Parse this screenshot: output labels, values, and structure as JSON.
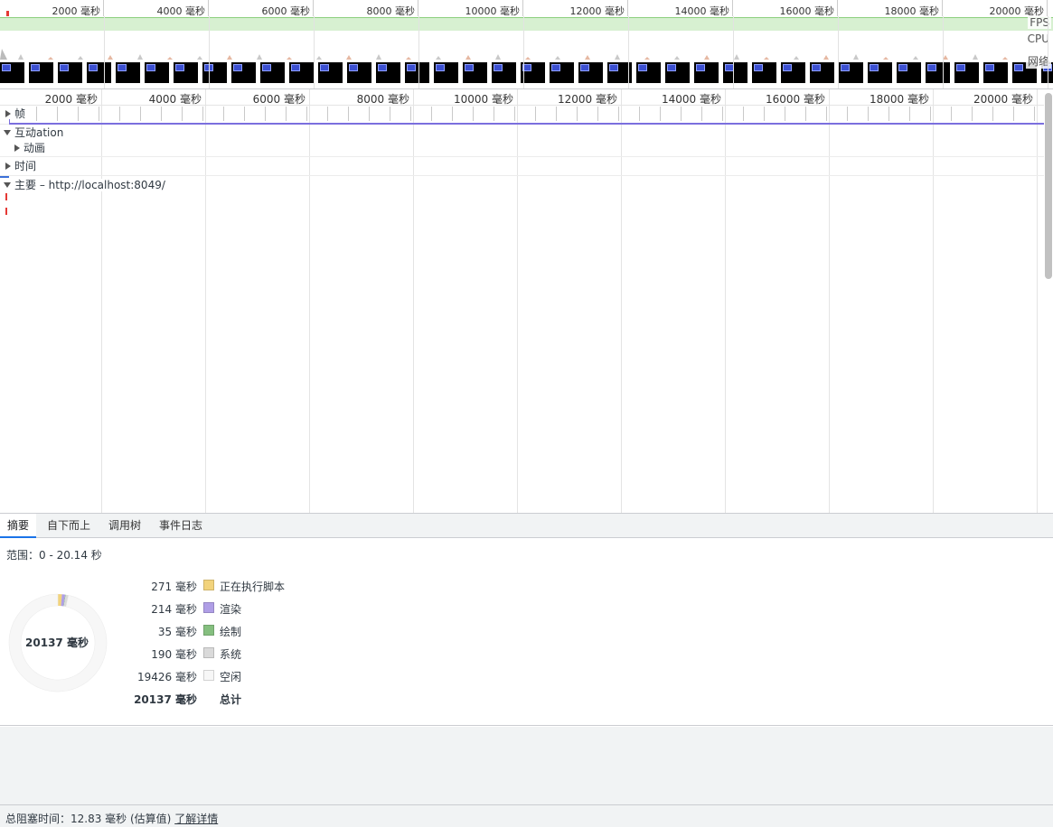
{
  "overview": {
    "ticks": [
      "2000 毫秒",
      "4000 毫秒",
      "6000 毫秒",
      "8000 毫秒",
      "10000 毫秒",
      "12000 毫秒",
      "14000 毫秒",
      "16000 毫秒",
      "18000 毫秒",
      "20000 毫秒"
    ],
    "lanes": {
      "fps": "FPS",
      "cpu": "CPU",
      "network": "网络"
    }
  },
  "timeline": {
    "ticks": [
      "2000 毫秒",
      "4000 毫秒",
      "6000 毫秒",
      "8000 毫秒",
      "10000 毫秒",
      "12000 毫秒",
      "14000 毫秒",
      "16000 毫秒",
      "18000 毫秒",
      "20000 毫秒"
    ],
    "tracks": {
      "frames": "帧",
      "interactions": "互动ation",
      "animations": "动画",
      "timings": "时间",
      "main": "主要 – http://localhost:8049/"
    }
  },
  "tabs": [
    "摘要",
    "自下而上",
    "调用树",
    "事件日志"
  ],
  "summary": {
    "range": "范围：0 - 20.14 秒",
    "total_center": "20137 毫秒",
    "items": [
      {
        "value": "271 毫秒",
        "label": "正在执行脚本",
        "color": "#f2d37c",
        "ms": 271
      },
      {
        "value": "214 毫秒",
        "label": "渲染",
        "color": "#af9ee6",
        "ms": 214
      },
      {
        "value": "35 毫秒",
        "label": "绘制",
        "color": "#85bf7f",
        "ms": 35
      },
      {
        "value": "190 毫秒",
        "label": "系统",
        "color": "#dadada",
        "ms": 190
      },
      {
        "value": "19426 毫秒",
        "label": "空闲",
        "color": "#f7f7f7",
        "ms": 19426
      }
    ],
    "total": {
      "value": "20137 毫秒",
      "label": "总计"
    }
  },
  "footer": {
    "text": "总阻塞时间：12.83 毫秒 (估算值)",
    "link": "了解详情"
  }
}
